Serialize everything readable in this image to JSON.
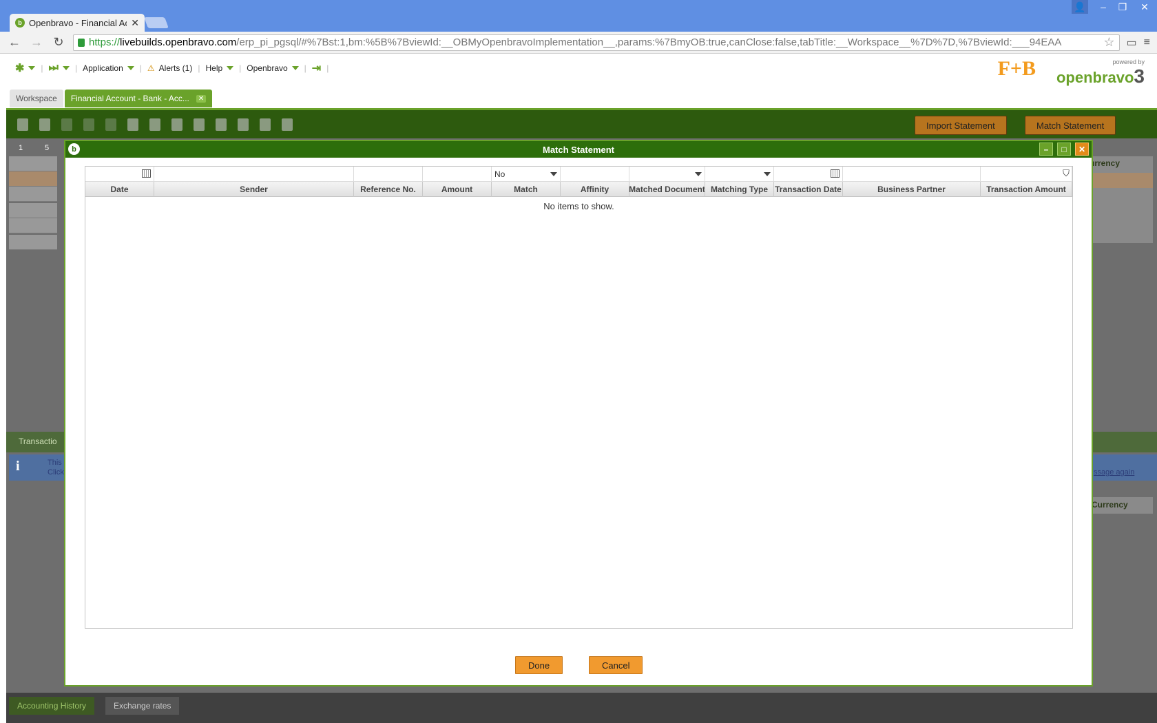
{
  "browser": {
    "tab_title": "Openbravo - Financial Acc",
    "url_scheme": "https://",
    "url_host": "livebuilds.openbravo.com",
    "url_path": "/erp_pi_pgsql/#%7Bst:1,bm:%5B%7BviewId:__OBMyOpenbravoImplementation__,params:%7BmyOB:true,canClose:false,tabTitle:__Workspace__%7D%7D,%7BviewId:___94EAA"
  },
  "nav": {
    "application": "Application",
    "alerts": "Alerts (1)",
    "help": "Help",
    "openbravo": "Openbravo"
  },
  "logos": {
    "fb": "F+B",
    "powered_by": "powered by",
    "brand": "openbravo",
    "version": "3"
  },
  "app_tabs": {
    "workspace": "Workspace",
    "financial_account": "Financial Account - Bank - Acc..."
  },
  "toolbar": {
    "import_statement": "Import Statement",
    "match_statement": "Match Statement"
  },
  "background": {
    "col1": "1",
    "col2": "5",
    "currency_header": "urrency",
    "transaction_tab": "Transactio",
    "info_line1": "This",
    "info_line2": "Click",
    "message_again": "ssage again",
    "currency_header2": "Currency",
    "bottom_tabs": [
      "Accounting History",
      "Exchange rates"
    ]
  },
  "modal": {
    "title": "Match Statement",
    "filter_match_value": "No",
    "columns": [
      "Date",
      "Sender",
      "Reference No.",
      "Amount",
      "Match",
      "Affinity",
      "Matched Document",
      "Matching Type",
      "Transaction Date",
      "Business Partner",
      "Transaction Amount"
    ],
    "empty_message": "No items to show.",
    "done": "Done",
    "cancel": "Cancel"
  }
}
